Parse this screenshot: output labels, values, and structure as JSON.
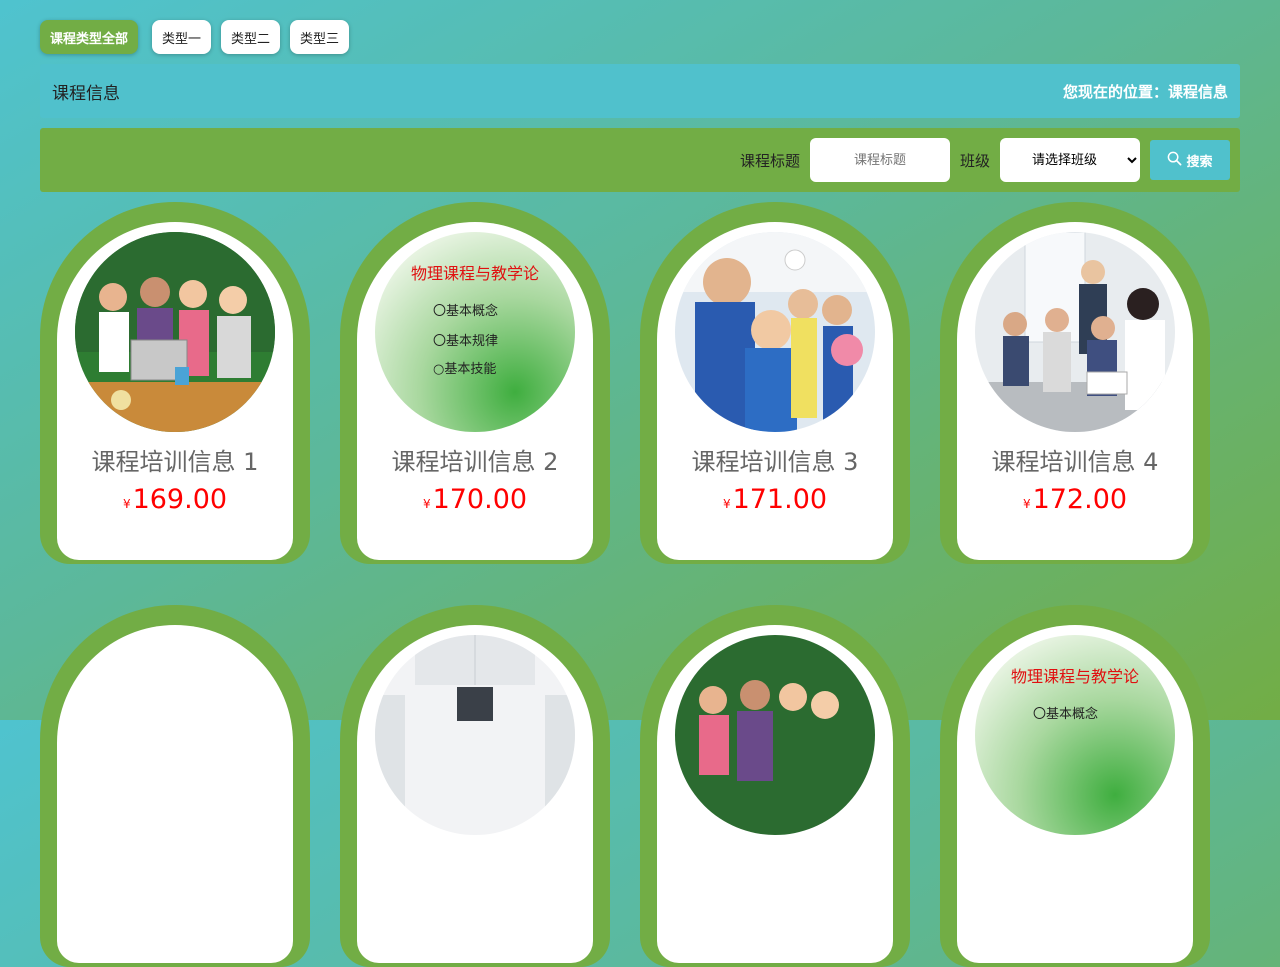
{
  "tabs": [
    {
      "label": "课程类型全部",
      "active": true
    },
    {
      "label": "类型一",
      "active": false
    },
    {
      "label": "类型二",
      "active": false
    },
    {
      "label": "类型三",
      "active": false
    }
  ],
  "infobar": {
    "title": "课程信息",
    "location_prefix": "您现在的位置：",
    "location": "课程信息"
  },
  "search": {
    "title_label": "课程标题",
    "title_placeholder": "课程标题",
    "class_label": "班级",
    "class_select_value": "请选择班级",
    "button_label": "搜索",
    "button_icon": "search-icon"
  },
  "colors": {
    "green": "#72ad45",
    "teal": "#50c1cc",
    "price": "#ff0000"
  },
  "courses": [
    {
      "name": "课程培训信息 1",
      "currency": "¥",
      "price": "169.00",
      "image": "classroom-kids-laptop"
    },
    {
      "name": "课程培训信息 2",
      "currency": "¥",
      "price": "170.00",
      "image": "physics-course-slide",
      "image_text": {
        "title": "物理课程与教学论",
        "items": [
          "〇基本概念",
          "〇基本规律",
          "○基本技能"
        ]
      }
    },
    {
      "name": "课程培训信息 3",
      "currency": "¥",
      "price": "171.00",
      "image": "smiling-kids"
    },
    {
      "name": "课程培训信息 4",
      "currency": "¥",
      "price": "172.00",
      "image": "students-classroom-desks"
    },
    {
      "name": "",
      "image": "blank"
    },
    {
      "name": "",
      "image": "empty-classroom"
    },
    {
      "name": "",
      "image": "classroom-kids-laptop"
    },
    {
      "name": "",
      "image": "physics-course-slide",
      "image_text": {
        "title": "物理课程与教学论",
        "items": [
          "〇基本概念"
        ]
      }
    }
  ]
}
